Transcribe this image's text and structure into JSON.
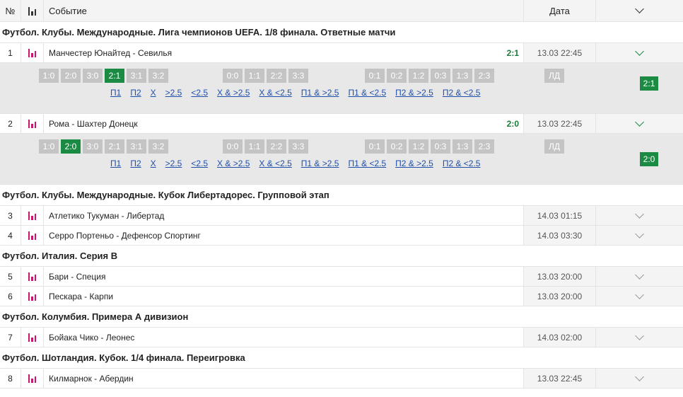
{
  "header": {
    "num": "№",
    "event": "Событие",
    "date": "Дата"
  },
  "groups": [
    {
      "title": "Футбол. Клубы. Международные. Лига чемпионов UEFA. 1/8 финала. Ответные матчи"
    },
    {
      "title": "Футбол. Клубы. Международные. Кубок Либертадорес. Групповой этап"
    },
    {
      "title": "Футбол. Италия. Серия B"
    },
    {
      "title": "Футбол. Колумбия. Примера А дивизион"
    },
    {
      "title": "Футбол. Шотландия. Кубок. 1/4 финала. Переигровка"
    }
  ],
  "matches": [
    {
      "num": "1",
      "name": "Манчестер Юнайтед - Севилья",
      "score": "2:1",
      "date": "13.03 22:45",
      "expanded": true
    },
    {
      "num": "2",
      "name": "Рома - Шахтер Донецк",
      "score": "2:0",
      "date": "13.03 22:45",
      "expanded": true
    },
    {
      "num": "3",
      "name": "Атлетико Тукуман - Либертад",
      "score": "",
      "date": "14.03 01:15",
      "expanded": false
    },
    {
      "num": "4",
      "name": "Серро Портеньо - Дефенсор Спортинг",
      "score": "",
      "date": "14.03 03:30",
      "expanded": false
    },
    {
      "num": "5",
      "name": "Бари - Специя",
      "score": "",
      "date": "13.03 20:00",
      "expanded": false
    },
    {
      "num": "6",
      "name": "Пескара - Карпи",
      "score": "",
      "date": "13.03 20:00",
      "expanded": false
    },
    {
      "num": "7",
      "name": "Бойака Чико - Леонес",
      "score": "",
      "date": "14.03 02:00",
      "expanded": false
    },
    {
      "num": "8",
      "name": "Килмарнок - Абердин",
      "score": "",
      "date": "13.03 22:45",
      "expanded": false
    }
  ],
  "score_grid": {
    "home_wins": [
      "1:0",
      "2:0",
      "3:0",
      "2:1",
      "3:1",
      "3:2"
    ],
    "draws": [
      "0:0",
      "1:1",
      "2:2",
      "3:3"
    ],
    "away_wins": [
      "0:1",
      "0:2",
      "1:2",
      "0:3",
      "1:3",
      "2:3"
    ],
    "other_label": "ЛД"
  },
  "bet_links": [
    "П1",
    "П2",
    "Х",
    ">2.5",
    "<2.5",
    "Х & >2.5",
    "Х & <2.5",
    "П1 & >2.5",
    "П1 & <2.5",
    "П2 & >2.5",
    "П2 & <2.5"
  ],
  "panels": [
    {
      "winning_score": "2:1",
      "result": "2:1"
    },
    {
      "winning_score": "2:0",
      "result": "2:0"
    }
  ],
  "colors": {
    "accent_green": "#1b8a43",
    "stats_icon": "#c8166e",
    "link_blue": "#1f4fa8",
    "inactive_chip": "#c4c4c4"
  },
  "icons": {
    "stats": "bar-chart-icon",
    "expand": "chevron-down-icon"
  }
}
